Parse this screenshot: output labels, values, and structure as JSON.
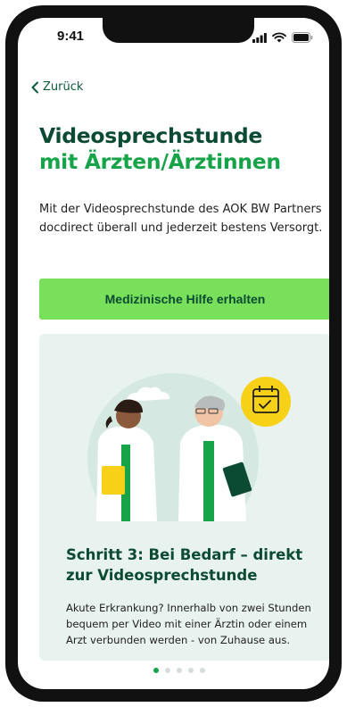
{
  "status_bar": {
    "time": "9:41"
  },
  "nav": {
    "back_label": "Zurück"
  },
  "header": {
    "title_line1": "Videosprechstunde",
    "title_line2": "mit Ärzten/Ärztinnen"
  },
  "intro": {
    "text": "Mit der Videosprechstunde des AOK BW Partners docdirect überall und jederzeit bestens Versorgt."
  },
  "cta": {
    "label": "Medizinische Hilfe erhalten"
  },
  "step_card": {
    "title": "Schritt 3: Bei Bedarf – direkt zur Videosprechstunde",
    "text": "Akute Erkrankung? Innerhalb von zwei Stunden bequem per Video mit einer Ärztin oder einem Arzt verbunden werden - von Zuhause aus."
  },
  "pagination": {
    "total": 5,
    "active": 0
  },
  "colors": {
    "primary_dark": "#0b4a33",
    "primary_green": "#17a348",
    "cta_green": "#78e05a",
    "card_bg": "#e8f2ef",
    "accent_yellow": "#f7d117"
  },
  "icons": [
    "back-chevron-icon",
    "signal-icon",
    "wifi-icon",
    "battery-icon",
    "calendar-check-icon"
  ]
}
